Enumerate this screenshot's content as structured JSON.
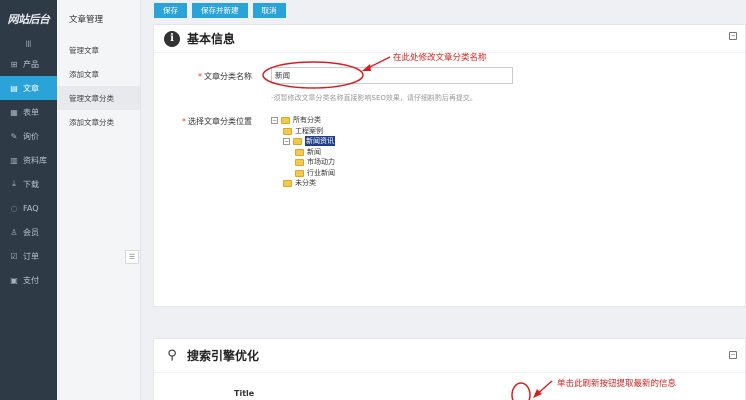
{
  "logo": "网站后台",
  "nav": {
    "toggle_icon": "hamburger-icon",
    "items": [
      {
        "icon": "product-icon",
        "label": "产品"
      },
      {
        "icon": "article-icon",
        "label": "文章"
      },
      {
        "icon": "form-icon",
        "label": "表单"
      },
      {
        "icon": "inquiry-icon",
        "label": "询价"
      },
      {
        "icon": "library-icon",
        "label": "资料库"
      },
      {
        "icon": "download-icon",
        "label": "下载"
      },
      {
        "icon": "faq-icon",
        "label": "FAQ"
      },
      {
        "icon": "member-icon",
        "label": "会员"
      },
      {
        "icon": "order-icon",
        "label": "订单"
      },
      {
        "icon": "payment-icon",
        "label": "支付"
      }
    ],
    "active_index": 1
  },
  "sub": {
    "title": "文章管理",
    "items": [
      "管理文章",
      "添加文章",
      "管理文章分类",
      "添加文章分类"
    ],
    "active_index": 2
  },
  "toolbar": {
    "save": "保存",
    "save_new": "保存并新建",
    "cancel": "取消"
  },
  "basic": {
    "title": "基本信息",
    "name_label": "文章分类名称",
    "name_value": "新闻",
    "hint": "-须暂修改文章分类名称直接影响SEO效果，请仔细斟酌后再提交。",
    "position_label": "选择文章分类位置",
    "tree": {
      "root": "所有分类",
      "n1": "工程案例",
      "n2": "新闻资讯",
      "n3": "新闻",
      "n4": "市场动力",
      "n5": "行业新闻",
      "n6": "未分类"
    }
  },
  "seo": {
    "title": "搜索引擎优化",
    "title_label": "Title"
  },
  "annotations": {
    "a1": "在此处修改文章分类名称",
    "a2": "单击此刷新按钮提取最新的信息"
  },
  "colors": {
    "accent": "#2aa3d8",
    "nav_bg": "#2f3a47",
    "annotation": "#d61f1f"
  }
}
